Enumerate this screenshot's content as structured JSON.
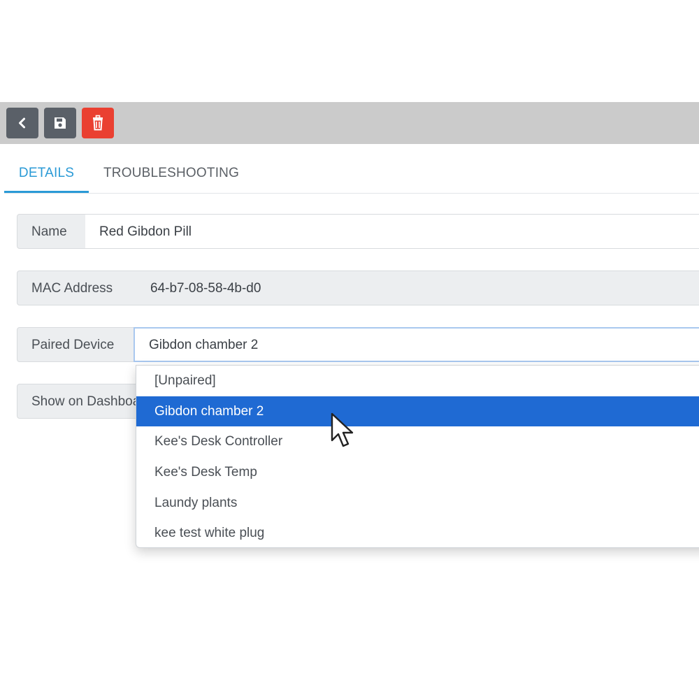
{
  "toolbar": {
    "back_icon": "chevron-left-icon",
    "save_icon": "floppy-disk-icon",
    "delete_icon": "trash-icon",
    "colors": {
      "toolbar_bg": "#cbcbcb",
      "button_bg": "#5a6068",
      "delete_bg": "#ea4031"
    }
  },
  "tabs": [
    {
      "label": "DETAILS",
      "active": true
    },
    {
      "label": "TROUBLESHOOTING",
      "active": false
    }
  ],
  "form": {
    "name": {
      "label": "Name",
      "value": "Red Gibdon Pill"
    },
    "mac": {
      "label": "MAC Address",
      "value": "64-b7-08-58-4b-d0"
    },
    "paired": {
      "label": "Paired Device",
      "value": "Gibdon chamber 2"
    },
    "dashboard": {
      "label": "Show on Dashboard"
    }
  },
  "dropdown": {
    "options": [
      {
        "label": "[Unpaired]",
        "selected": false
      },
      {
        "label": "Gibdon chamber 2",
        "selected": true
      },
      {
        "label": "Kee's Desk Controller",
        "selected": false
      },
      {
        "label": "Kee's Desk Temp",
        "selected": false
      },
      {
        "label": "Laundy plants",
        "selected": false
      },
      {
        "label": "kee test white plug",
        "selected": false
      }
    ],
    "colors": {
      "selected_bg": "#1f6ad3",
      "accent": "#2a9ad6"
    }
  }
}
